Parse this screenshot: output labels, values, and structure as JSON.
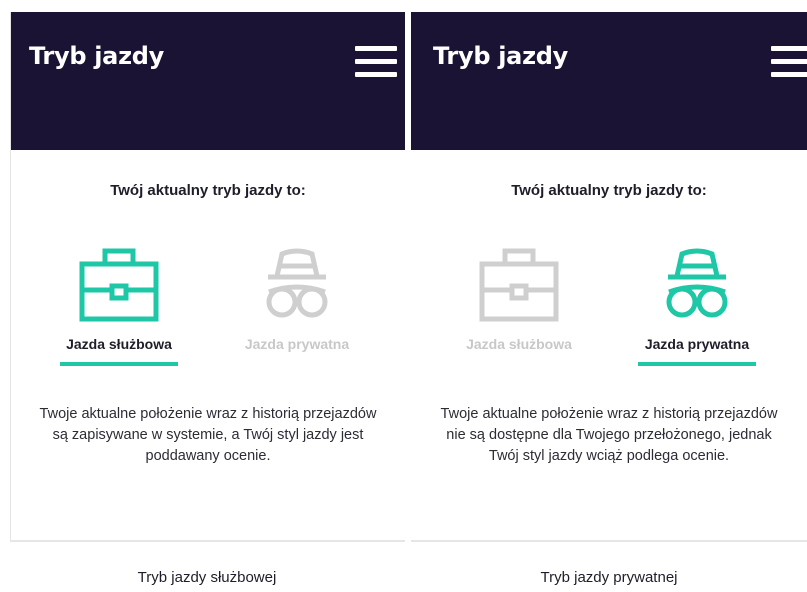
{
  "colors": {
    "header_bg": "#1b1333",
    "accent": "#1ec7a6",
    "inactive": "#cfcfcf"
  },
  "left_screen": {
    "app_title": "Tryb jazdy",
    "menu_icon": "hamburger-menu-icon",
    "heading": "Twój aktualny tryb jazdy to:",
    "modes": [
      {
        "label": "Jazda służbowa",
        "icon": "briefcase-icon",
        "selected": true
      },
      {
        "label": "Jazda prywatna",
        "icon": "incognito-hat-glasses-icon",
        "selected": false
      }
    ],
    "description": "Twoje aktualne położenie wraz z historią przejazdów są zapisywane w systemie, a Twój styl jazdy jest poddawany ocenie."
  },
  "right_screen": {
    "app_title": "Tryb jazdy",
    "menu_icon": "hamburger-menu-icon",
    "heading": "Twój aktualny tryb jazdy to:",
    "modes": [
      {
        "label": "Jazda służbowa",
        "icon": "briefcase-icon",
        "selected": false
      },
      {
        "label": "Jazda prywatna",
        "icon": "incognito-hat-glasses-icon",
        "selected": true
      }
    ],
    "description": "Twoje aktualne położenie wraz z historią przejazdów nie są dostępne dla Twojego przełożonego, jednak Twój styl jazdy wciąż podlega ocenie."
  },
  "captions": {
    "left": "Tryb jazdy służbowej",
    "right": "Tryb jazdy prywatnej"
  }
}
